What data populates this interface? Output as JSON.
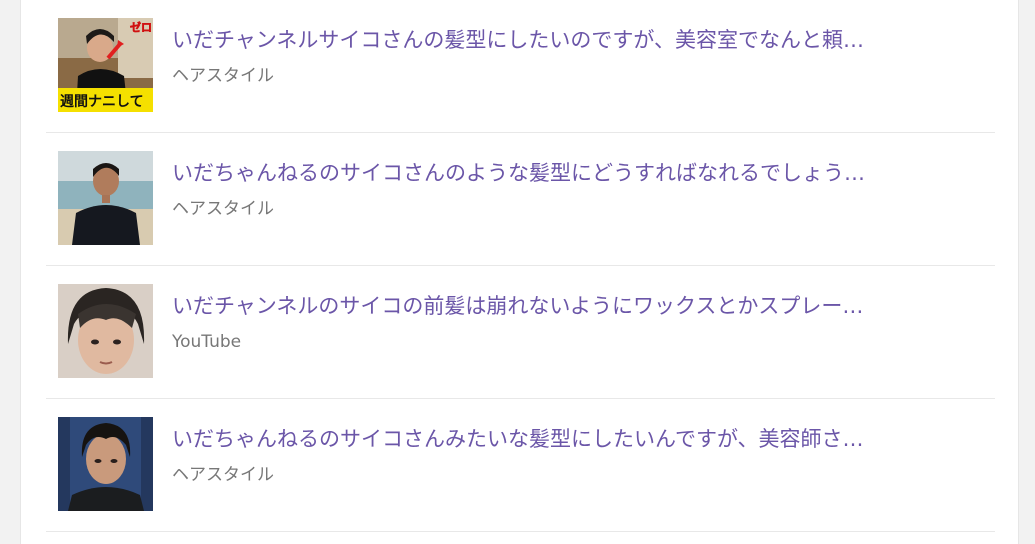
{
  "results": [
    {
      "title": "いだチャンネルサイコさんの髪型にしたいのですが、美容室でなんと頼…",
      "category": "ヘアスタイル",
      "thumbnail_caption_top": "ゼロ",
      "thumbnail_caption_bottom": "週間ナニして"
    },
    {
      "title": "いだちゃんねるのサイコさんのような髪型にどうすればなれるでしょう…",
      "category": "ヘアスタイル"
    },
    {
      "title": "いだチャンネルのサイコの前髪は崩れないようにワックスとかスプレー…",
      "category": "YouTube"
    },
    {
      "title": "いだちゃんねるのサイコさんみたいな髪型にしたいんですが、美容師さ…",
      "category": "ヘアスタイル"
    }
  ],
  "colors": {
    "title": "#6b56a8",
    "category": "#777777",
    "divider": "#e8e8e8",
    "background": "#ffffff",
    "page_background": "#f2f2f2"
  }
}
